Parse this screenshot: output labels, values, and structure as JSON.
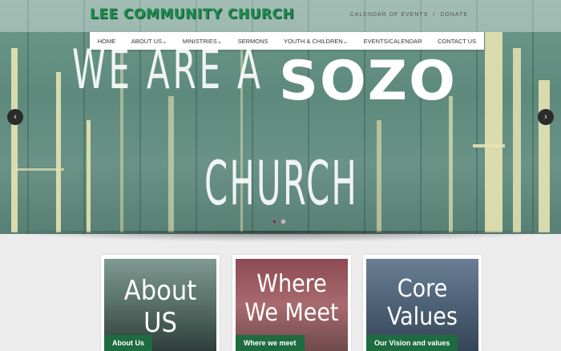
{
  "header": {
    "logo": "LEE COMMUNITY CHURCH",
    "top_links": [
      "CALENDAR OF EVENTS",
      "/",
      "DONATE"
    ]
  },
  "nav": {
    "items": [
      "HOME",
      "ABOUT US⌄",
      "MINISTRIES⌄",
      "SERMONS",
      "YOUTH & CHILDREN⌄",
      "EVENTS/CALENDAR",
      "CONTACT US"
    ]
  },
  "hero": {
    "line1": "WE ARE A",
    "line2": "SOZO",
    "line3": "CHURCH",
    "prev_icon": "chevron-left-icon",
    "next_icon": "chevron-right-icon",
    "prev_glyph": "‹",
    "next_glyph": "›",
    "slides": 2,
    "active_slide": 1
  },
  "cards": [
    {
      "title": "About US",
      "label": "About Us"
    },
    {
      "title": "Where We Meet",
      "label": "Where we meet"
    },
    {
      "title": "Core Values",
      "label": "Our Vision and values"
    }
  ],
  "colors": {
    "brand_green": "#1f8a4f",
    "label_green": "#1d6b3e"
  }
}
